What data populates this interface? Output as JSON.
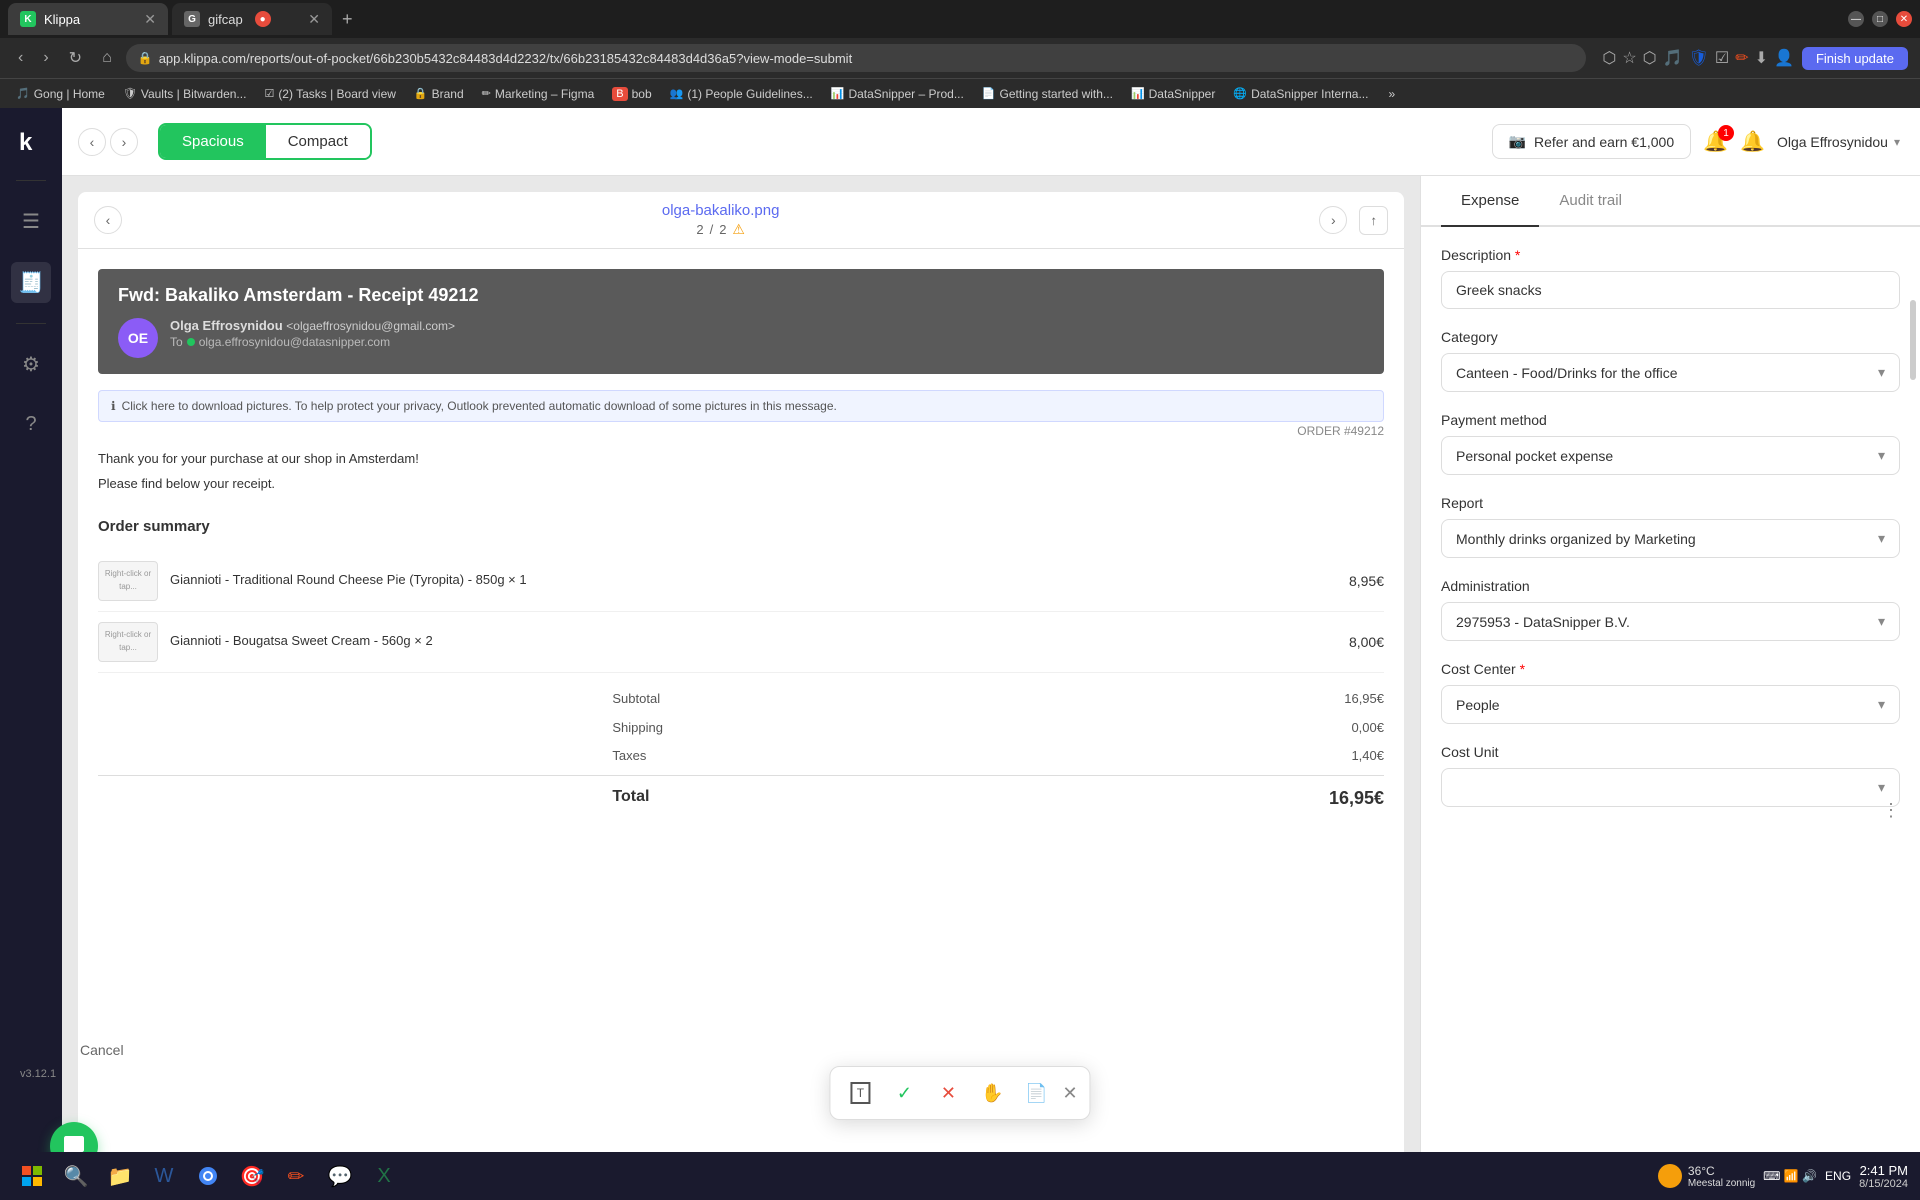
{
  "browser": {
    "tabs": [
      {
        "label": "Klippa",
        "icon": "K",
        "active": true,
        "favicon_color": "#22c55e"
      },
      {
        "label": "gifcap",
        "icon": "G",
        "active": false,
        "favicon_color": "#888"
      }
    ],
    "url": "app.klippa.com/reports/out-of-pocket/66b230b5432c84483d4d2232/tx/66b23185432c84483d4d36a5?view-mode=submit",
    "finish_update": "Finish update"
  },
  "bookmarks": [
    {
      "label": "Brand",
      "icon": "🔒"
    },
    {
      "label": "– Figma",
      "icon": "✏"
    },
    {
      "label": "Marketing – Figma",
      "icon": "✏"
    },
    {
      "label": "bob",
      "icon": "B"
    },
    {
      "label": "(1) People Guidelines...",
      "icon": "👥"
    },
    {
      "label": "DataSnipper – Prod...",
      "icon": "📊"
    },
    {
      "label": "Getting started with...",
      "icon": "📄"
    },
    {
      "label": "DataSnipper",
      "icon": "📊"
    },
    {
      "label": "DataSnipper Interna...",
      "icon": "🌐"
    }
  ],
  "header": {
    "view_spacious": "Spacious",
    "view_compact": "Compact",
    "refer_btn": "Refer and earn €1,000",
    "notifications_count": "1",
    "user_name": "Olga Effrosynidou"
  },
  "document": {
    "filename": "olga-bakaliko.png",
    "page_current": "2",
    "page_total": "2",
    "has_warning": true,
    "email": {
      "subject": "Fwd: Bakaliko Amsterdam - Receipt 49212",
      "from_name": "Olga Effrosynidou",
      "from_email": "<olgaeffrosynidou@gmail.com>",
      "to": "olga.effrosynidou@datasnipper.com",
      "avatar_initials": "OE",
      "privacy_notice": "Click here to download pictures. To help protect your privacy, Outlook prevented automatic download of some pictures in this message.",
      "order_ref": "ORDER #49212",
      "thank_you": "Thank you for your purchase at our shop in Amsterdam!",
      "find_below": "Please find below your receipt.",
      "order_summary_title": "Order summary",
      "items": [
        {
          "name": "Giannioti - Traditional Round Cheese Pie (Tyropita) - 850g × 1",
          "price": "8,95€"
        },
        {
          "name": "Giannioti - Bougatsa Sweet Cream - 560g × 2",
          "price": "8,00€"
        }
      ],
      "subtotal_label": "Subtotal",
      "subtotal_value": "16,95€",
      "shipping_label": "Shipping",
      "shipping_value": "0,00€",
      "taxes_label": "Taxes",
      "taxes_value": "1,40€",
      "total_label": "Total",
      "total_value": "16,95€"
    }
  },
  "right_panel": {
    "tab_expense": "Expense",
    "tab_audit": "Audit trail",
    "description_label": "Description",
    "description_value": "Greek snacks",
    "description_placeholder": "Greek snacks",
    "category_label": "Category",
    "category_value": "Canteen - Food/Drinks for the office",
    "payment_method_label": "Payment method",
    "payment_method_value": "Personal pocket expense",
    "report_label": "Report",
    "report_value": "Monthly drinks organized by Marketing",
    "administration_label": "Administration",
    "administration_value": "2975953 - DataSnipper B.V.",
    "cost_center_label": "Cost Center",
    "cost_center_value": "People",
    "cost_unit_label": "Cost Unit"
  },
  "toolbar": {
    "cancel_label": "Cancel",
    "version": "v3.12.1"
  },
  "taskbar": {
    "time": "2:41 PM",
    "date": "8/15/2024",
    "language": "ENG",
    "temperature": "36°C",
    "weather": "Meestal zonnig"
  },
  "icons": {
    "list_icon": "☰",
    "receipt_icon": "🧾",
    "settings_icon": "⚙",
    "help_icon": "?",
    "lock_icon": "🔒",
    "star_icon": "☆",
    "refresh_icon": "↻",
    "back_icon": "←",
    "forward_icon": "→",
    "home_icon": "⌂",
    "search_icon": "🔍",
    "download_icon": "⬇",
    "extension_icon": "⬡",
    "profile_icon": "👤",
    "bell_icon": "🔔",
    "camera_icon": "📷",
    "crop_icon": "✂",
    "text_icon": "T",
    "check_icon": "✓",
    "x_icon": "✕",
    "hand_icon": "✋",
    "doc_icon": "📄"
  }
}
